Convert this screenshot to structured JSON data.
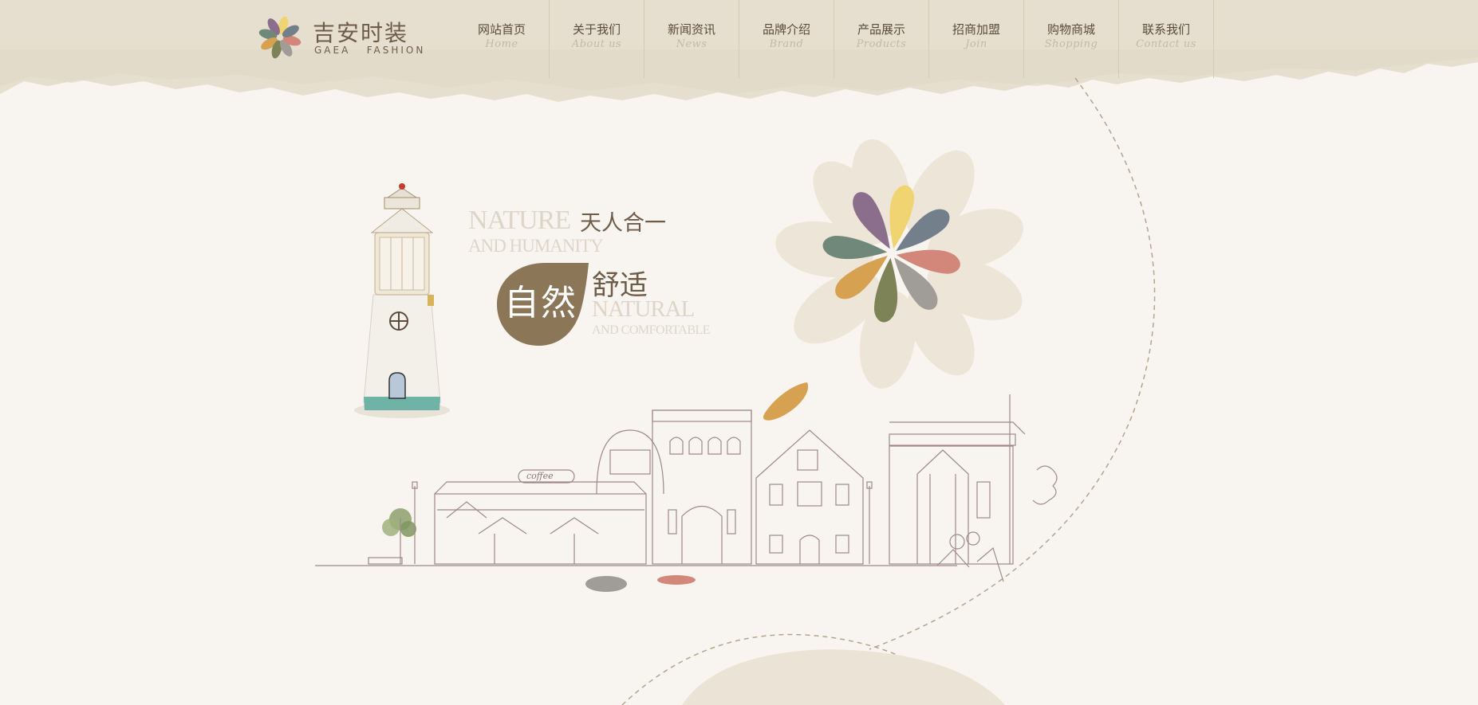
{
  "brand": {
    "name_cn": "吉安时装",
    "name_en": "GAEA   FASHION",
    "logo_icon": "flower-petals-icon"
  },
  "nav": [
    {
      "cn": "网站首页",
      "en": "Home"
    },
    {
      "cn": "关于我们",
      "en": "About us"
    },
    {
      "cn": "新闻资讯",
      "en": "News"
    },
    {
      "cn": "品牌介绍",
      "en": "Brand"
    },
    {
      "cn": "产品展示",
      "en": "Products"
    },
    {
      "cn": "招商加盟",
      "en": "Join"
    },
    {
      "cn": "购物商城",
      "en": "Shopping"
    },
    {
      "cn": "联系我们",
      "en": "Contact us"
    }
  ],
  "hero": {
    "line1_en": "NATURE",
    "line1_cn": "天人合一",
    "line2_en": "AND HUMANITY",
    "badge_cn": "自然",
    "line3_cn": "舒适",
    "line4_en": "NATURAL",
    "line5_en": "AND COMFORTABLE",
    "sign_text": "coffee"
  },
  "colors": {
    "header_bg": "#e6dfcf",
    "page_bg": "#f8f5f0",
    "brand_brown": "#8b7658",
    "petal_purple": "#8a6e8c",
    "petal_yellow": "#f1d472",
    "petal_slate": "#737f8a",
    "petal_salmon": "#d2877a",
    "petal_grey": "#a09d98",
    "petal_olive": "#7e8257",
    "petal_orange": "#d6a252",
    "petal_green": "#70887a"
  }
}
